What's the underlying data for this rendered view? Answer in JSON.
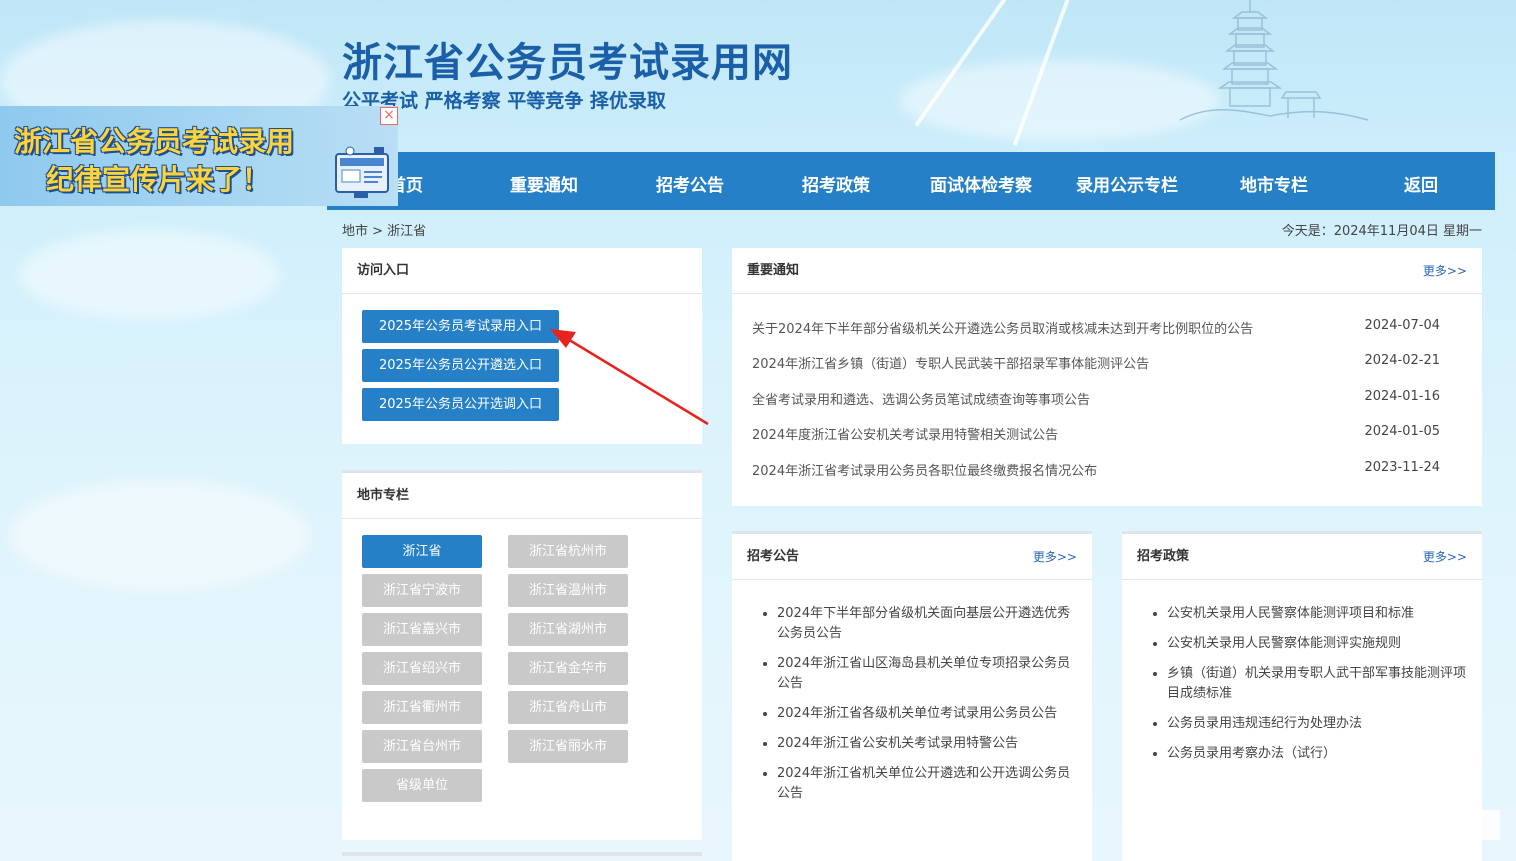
{
  "header": {
    "title": "浙江省公务员考试录用网",
    "slogan": "公平考试 严格考察 平等竞争 择优录取"
  },
  "nav": {
    "items": [
      {
        "label": "首页"
      },
      {
        "label": "重要通知"
      },
      {
        "label": "招考公告"
      },
      {
        "label": "招考政策"
      },
      {
        "label": "面试体检考察"
      },
      {
        "label": "录用公示专栏"
      },
      {
        "label": "地市专栏"
      },
      {
        "label": "返回"
      }
    ]
  },
  "promo": {
    "line1": "浙江省公务员考试录用",
    "line2": "纪律宣传片来了！",
    "close": "×"
  },
  "breadcrumb": "地市 > 浙江省",
  "today": "今天是：2024年11月04日 星期一",
  "access": {
    "title": "访问入口",
    "buttons": [
      "2025年公务员考试录用入口",
      "2025年公务员公开遴选入口",
      "2025年公务员公开选调入口"
    ]
  },
  "cities": {
    "title": "地市专栏",
    "items": [
      "浙江省",
      "浙江省杭州市",
      "浙江省宁波市",
      "浙江省温州市",
      "浙江省嘉兴市",
      "浙江省湖州市",
      "浙江省绍兴市",
      "浙江省金华市",
      "浙江省衢州市",
      "浙江省舟山市",
      "浙江省台州市",
      "浙江省丽水市",
      "省级单位"
    ],
    "active": "浙江省"
  },
  "notices": {
    "title": "重要通知",
    "more": "更多>>",
    "rows": [
      {
        "title": "关于2024年下半年部分省级机关公开遴选公务员取消或核减未达到开考比例职位的公告",
        "date": "2024-07-04"
      },
      {
        "title": "2024年浙江省乡镇（街道）专职人民武装干部招录军事体能测评公告",
        "date": "2024-02-21"
      },
      {
        "title": "全省考试录用和遴选、选调公务员笔试成绩查询等事项公告",
        "date": "2024-01-16"
      },
      {
        "title": "2024年度浙江省公安机关考试录用特警相关测试公告",
        "date": "2024-01-05"
      },
      {
        "title": "2024年浙江省考试录用公务员各职位最终缴费报名情况公布",
        "date": "2023-11-24"
      }
    ]
  },
  "announcements": {
    "title": "招考公告",
    "more": "更多>>",
    "items": [
      "2024年下半年部分省级机关面向基层公开遴选优秀公务员公告",
      "2024年浙江省山区海岛县机关单位专项招录公务员公告",
      "2024年浙江省各级机关单位考试录用公务员公告",
      "2024年浙江省公安机关考试录用特警公告",
      "2024年浙江省机关单位公开遴选和公开选调公务员公告"
    ]
  },
  "policies": {
    "title": "招考政策",
    "more": "更多>>",
    "items": [
      "公安机关录用人民警察体能测评项目和标准",
      "公安机关录用人民警察体能测评实施规则",
      "乡镇（街道）机关录用专职人武干部军事技能测评项目成绩标准",
      "公务员录用违规违纪行为处理办法",
      "公务员录用考察办法（试行）"
    ]
  },
  "colors": {
    "primary": "#2580c8",
    "title_blue": "#1a5fa8",
    "inactive_button": "#c9c9c9",
    "arrow_red": "#e8231f",
    "promo_yellow": "#ffd43a"
  }
}
